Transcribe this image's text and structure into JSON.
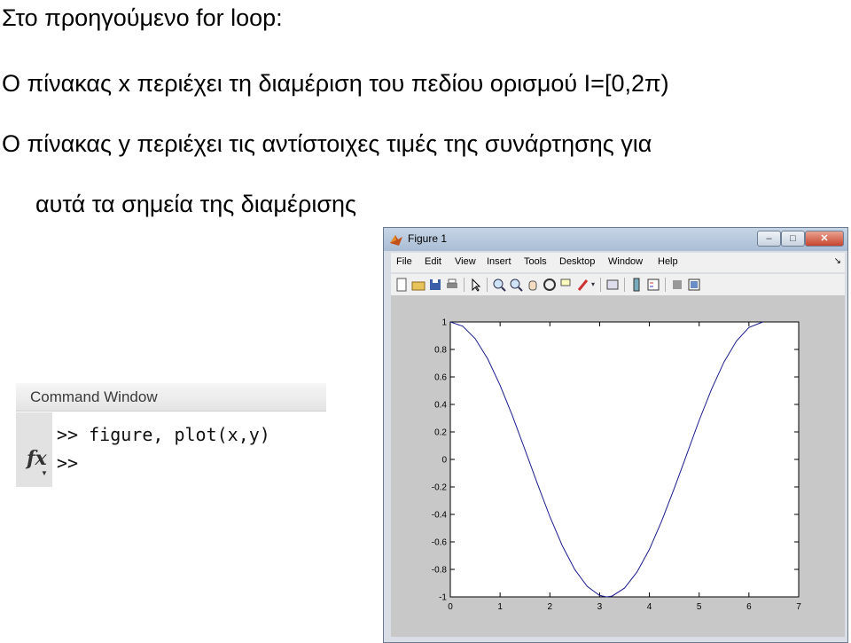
{
  "slide": {
    "line1": "Στο προηγούμενο for loop:",
    "line2": "O πίνακας x περιέχει τη διαμέριση του πεδίου ορισμού I=[0,2π)",
    "line3": "O πίνακας y περιέχει τις αντίστοιχες τιμές της συνάρτησης για",
    "line4": "αυτά τα σημεία της διαμέρισης"
  },
  "command_window": {
    "title": "Command Window",
    "line1": ">> figure, plot(x,y)",
    "line2": ">>",
    "fx_label": "fx"
  },
  "figure": {
    "title": "Figure 1",
    "menus": [
      "File",
      "Edit",
      "View",
      "Insert",
      "Tools",
      "Desktop",
      "Window",
      "Help"
    ],
    "dock_icon": "↘",
    "toolbar_icons": [
      "new-figure-icon",
      "open-file-icon",
      "save-icon",
      "print-icon",
      "edit-plot-icon",
      "zoom-in-icon",
      "zoom-out-icon",
      "pan-icon",
      "rotate-3d-icon",
      "data-cursor-icon",
      "brush-icon",
      "link-plot-icon",
      "colorbar-icon",
      "legend-icon",
      "hide-plot-tools-icon",
      "show-plot-tools-icon"
    ],
    "window_buttons": {
      "minimize": "–",
      "maximize": "□",
      "close": "✕"
    }
  },
  "chart_data": {
    "type": "line",
    "title": "",
    "xlabel": "",
    "ylabel": "",
    "xlim": [
      0,
      7
    ],
    "ylim": [
      -1,
      1
    ],
    "xticks": [
      "0",
      "1",
      "2",
      "3",
      "4",
      "5",
      "6",
      "7"
    ],
    "yticks": [
      "1",
      "0.8",
      "0.6",
      "0.4",
      "0.2",
      "0",
      "-0.2",
      "-0.4",
      "-0.6",
      "-0.8",
      "-1"
    ],
    "x": [
      0.0,
      0.25,
      0.5,
      0.75,
      1.0,
      1.25,
      1.5,
      1.75,
      2.0,
      2.25,
      2.5,
      2.75,
      3.0,
      3.14,
      3.25,
      3.5,
      3.75,
      4.0,
      4.25,
      4.5,
      4.75,
      5.0,
      5.25,
      5.5,
      5.75,
      6.0,
      6.28
    ],
    "series": [
      {
        "values": [
          1.0,
          0.969,
          0.878,
          0.732,
          0.54,
          0.315,
          0.071,
          -0.178,
          -0.416,
          -0.628,
          -0.801,
          -0.924,
          -0.99,
          -1.0,
          -0.994,
          -0.936,
          -0.82,
          -0.654,
          -0.446,
          -0.211,
          0.036,
          0.284,
          0.512,
          0.709,
          0.861,
          0.96,
          1.0
        ],
        "color": "#1a1a8c"
      }
    ],
    "grid": false
  }
}
